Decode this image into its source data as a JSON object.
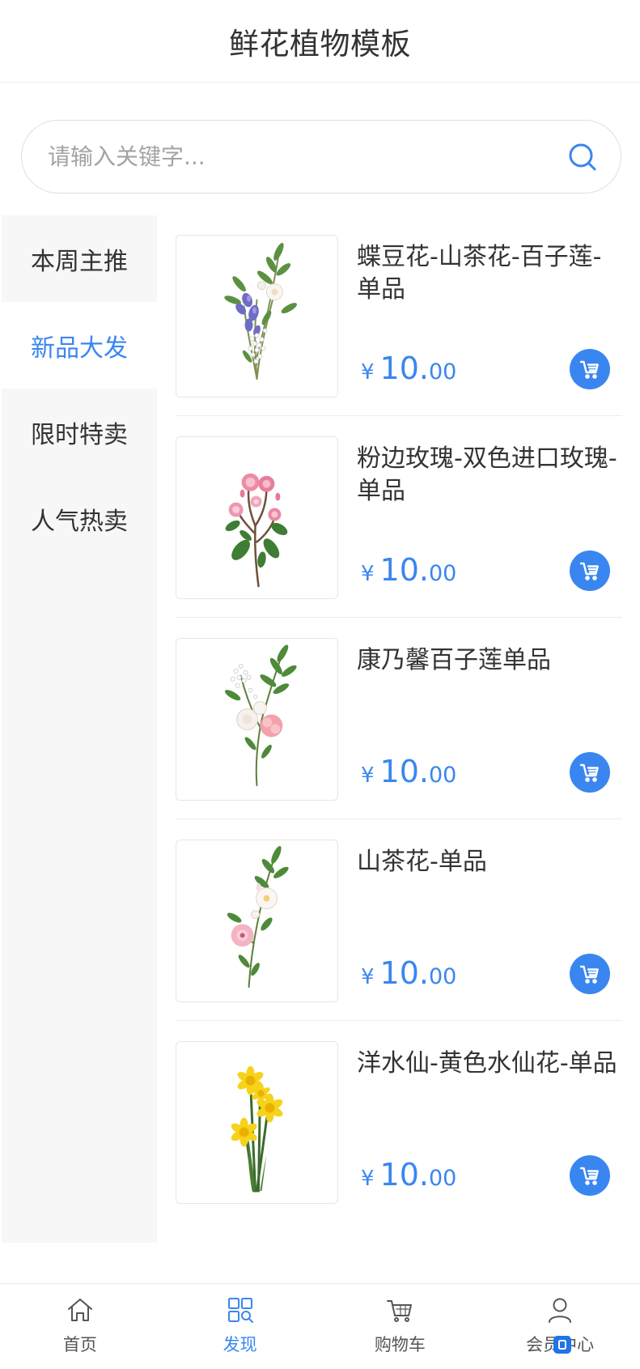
{
  "header": {
    "title": "鲜花植物模板"
  },
  "search": {
    "placeholder": "请输入关键字...",
    "value": "",
    "icon": "search-icon"
  },
  "sidebar": {
    "items": [
      {
        "label": "本周主推",
        "active": false
      },
      {
        "label": "新品大发",
        "active": true
      },
      {
        "label": "限时特卖",
        "active": false
      },
      {
        "label": "人气热卖",
        "active": false
      }
    ]
  },
  "products": [
    {
      "title": "蝶豆花-山茶花-百子莲-单品",
      "price": {
        "currency": "¥",
        "integer": "10.",
        "decimal": "00"
      },
      "cart_icon": "add-to-cart-icon"
    },
    {
      "title": "粉边玫瑰-双色进口玫瑰-单品",
      "price": {
        "currency": "¥",
        "integer": "10.",
        "decimal": "00"
      },
      "cart_icon": "add-to-cart-icon"
    },
    {
      "title": "康乃馨百子莲单品",
      "price": {
        "currency": "¥",
        "integer": "10.",
        "decimal": "00"
      },
      "cart_icon": "add-to-cart-icon"
    },
    {
      "title": "山茶花-单品",
      "price": {
        "currency": "¥",
        "integer": "10.",
        "decimal": "00"
      },
      "cart_icon": "add-to-cart-icon"
    },
    {
      "title": "洋水仙-黄色水仙花-单品",
      "price": {
        "currency": "¥",
        "integer": "10.",
        "decimal": "00"
      },
      "cart_icon": "add-to-cart-icon"
    }
  ],
  "tabbar": {
    "items": [
      {
        "label": "首页",
        "icon": "home-icon",
        "active": false
      },
      {
        "label": "发现",
        "icon": "discover-icon",
        "active": true
      },
      {
        "label": "购物车",
        "icon": "cart-icon",
        "active": false
      },
      {
        "label": "会员中心",
        "icon": "user-icon",
        "active": false
      }
    ]
  },
  "colors": {
    "accent": "#3a86f0",
    "text": "#333333",
    "muted": "#a3a3a3",
    "sidebar_bg": "#f7f7f7"
  }
}
